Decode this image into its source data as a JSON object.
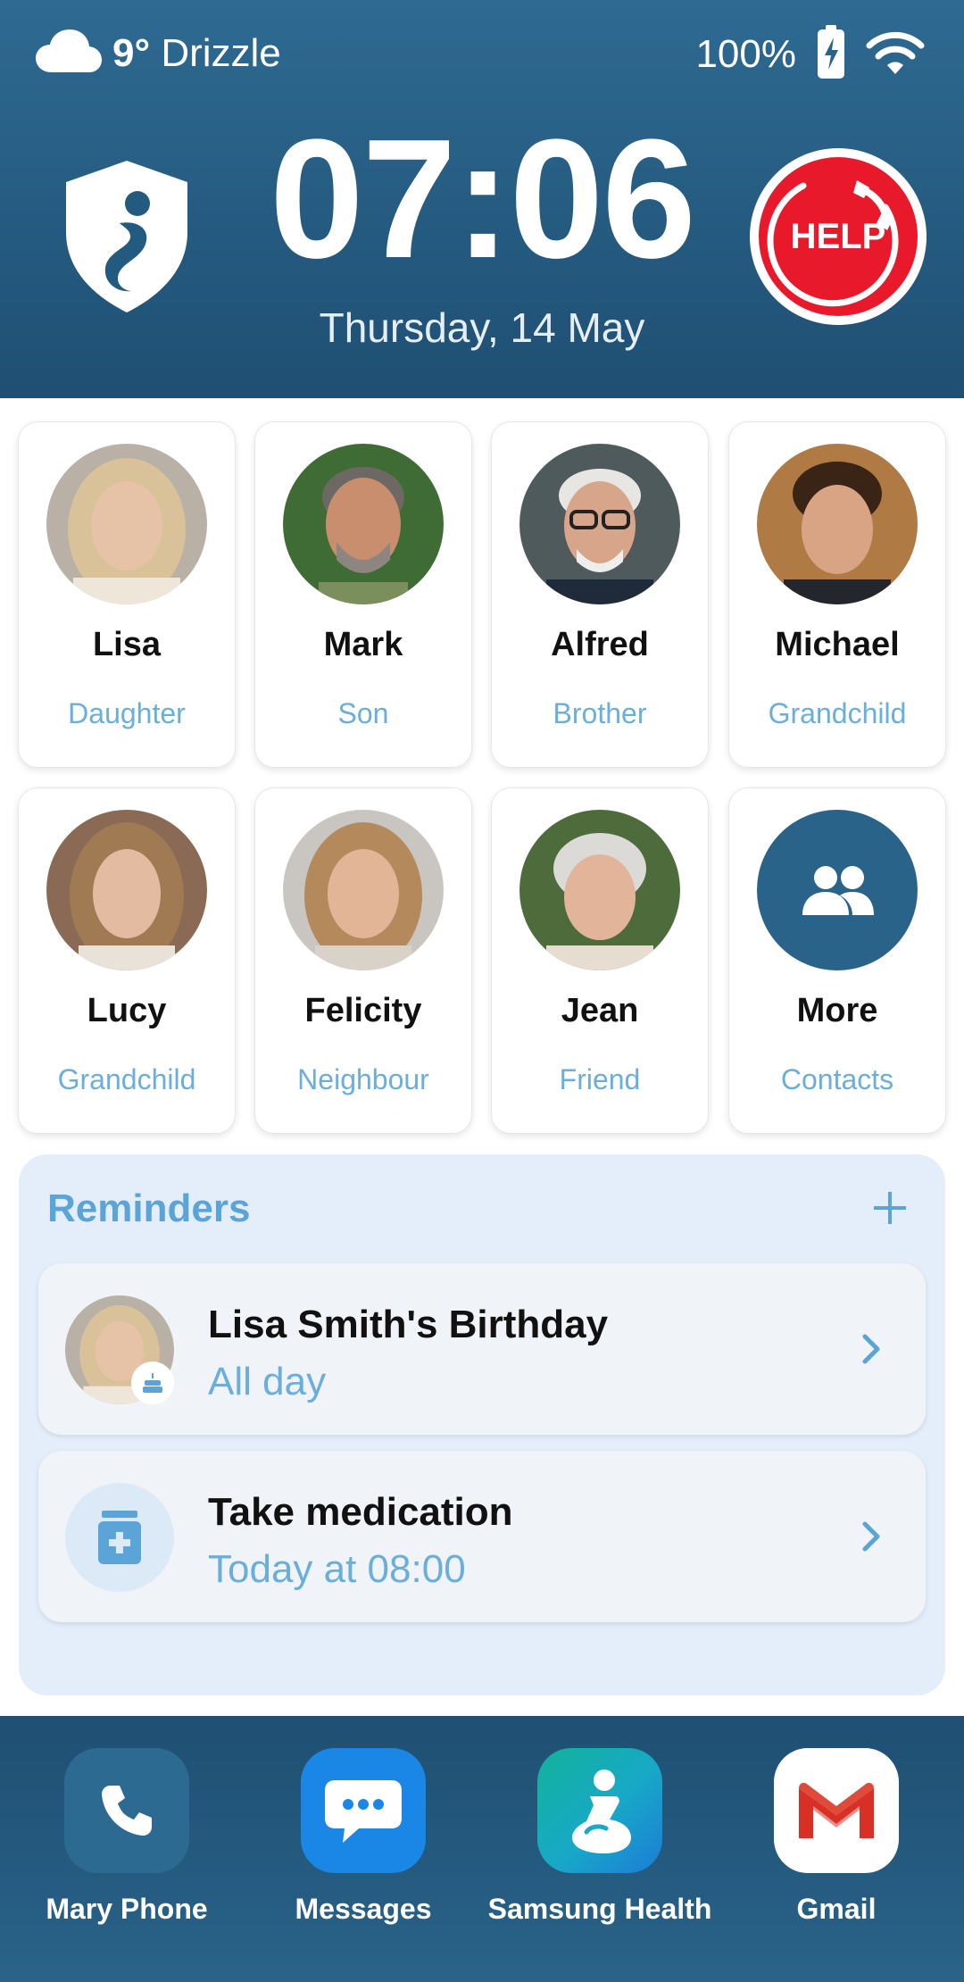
{
  "status": {
    "temperature": "9°",
    "weather": "Drizzle",
    "battery": "100%"
  },
  "header": {
    "time": "07:06",
    "date": "Thursday, 14 May",
    "help_label": "HELP"
  },
  "contacts": [
    {
      "name": "Lisa",
      "relation": "Daughter"
    },
    {
      "name": "Mark",
      "relation": "Son"
    },
    {
      "name": "Alfred",
      "relation": "Brother"
    },
    {
      "name": "Michael",
      "relation": "Grandchild"
    },
    {
      "name": "Lucy",
      "relation": "Grandchild"
    },
    {
      "name": "Felicity",
      "relation": "Neighbour"
    },
    {
      "name": "Jean",
      "relation": "Friend"
    },
    {
      "name": "More",
      "relation": "Contacts"
    }
  ],
  "reminders": {
    "title": "Reminders",
    "items": [
      {
        "title": "Lisa Smith's Birthday",
        "subtitle": "All day"
      },
      {
        "title": "Take medication",
        "subtitle": "Today at 08:00"
      }
    ]
  },
  "dock": [
    {
      "label": "Mary Phone",
      "icon": "phone-icon"
    },
    {
      "label": "Messages",
      "icon": "messages-icon"
    },
    {
      "label": "Samsung Health",
      "icon": "health-icon"
    },
    {
      "label": "Gmail",
      "icon": "gmail-icon"
    }
  ],
  "colors": {
    "header_bg": "#2e6a92",
    "accent_blue": "#6aaedc",
    "help_red": "#e8192a",
    "reminder_bg": "#e3eefa"
  }
}
